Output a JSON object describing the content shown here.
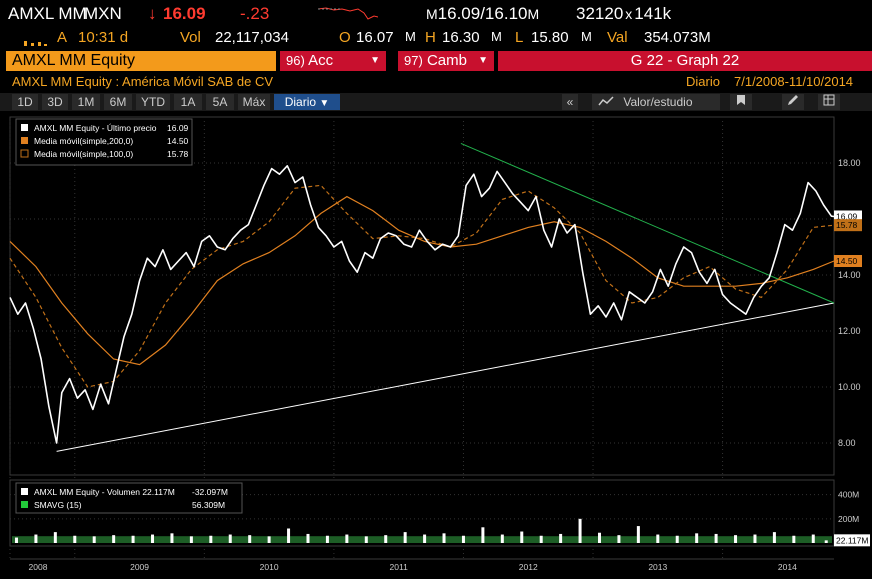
{
  "header": {
    "ticker": "AMXL MM",
    "currency": "MXN",
    "arrow": "↓",
    "last_price": "16.09",
    "change": "-.23",
    "bid_ask_prefix": "M",
    "bid_ask": "16.09/16.10",
    "bid_ask_suffix": "M",
    "sizes": "32120",
    "times": "x",
    "size2": "141k",
    "flag": "A",
    "time": "10:31 d",
    "vol_label": "Vol",
    "vol_value": "22,117,034",
    "open_label": "O",
    "open_value": "16.07",
    "open_suffix": "M",
    "high_label": "H",
    "high_value": "16.30",
    "high_suffix": "M",
    "low_label": "L",
    "low_value": "15.80",
    "low_suffix": "M",
    "val_label": "Val",
    "val_value": "354.073M"
  },
  "toolbar": {
    "security_field": "AMXL MM Equity",
    "acc_num": "96)",
    "acc_label": "Acc",
    "camb_num": "97)",
    "camb_label": "Camb",
    "graph_title": "G 22 - Graph 22"
  },
  "subheader": {
    "security_name": "AMXL MM Equity : América Móvil SAB de CV",
    "period": "Diario",
    "date_range": "7/1/2008-11/10/2014"
  },
  "range_tabs": [
    "1D",
    "3D",
    "1M",
    "6M",
    "YTD",
    "1A",
    "5A",
    "Máx"
  ],
  "frequency": "Diario",
  "frequency_arrow": "▼",
  "collapse_icon": "«",
  "study_label": "Valor/estudio",
  "chart_data": [
    {
      "type": "line",
      "legend": [
        {
          "name": "AMXL MM Equity - Último precio",
          "value": "16.09",
          "color": "#ffffff"
        },
        {
          "name": "Media móvil(simple,200,0)",
          "value": "14.50",
          "color": "#e08020"
        },
        {
          "name": "Media móvil(simple,100,0)",
          "value": "15.78",
          "color": "#c07018"
        }
      ],
      "y_ticks": [
        "8.00",
        "10.00",
        "12.00",
        "14.00",
        "16.00",
        "18.00"
      ],
      "ylim": [
        7.0,
        19.5
      ],
      "x_ticks": [
        "2008",
        "2009",
        "2010",
        "2011",
        "2012",
        "2013",
        "2014"
      ],
      "x_tick_dates": [
        2008.5,
        2009.0,
        2010.0,
        2011.0,
        2012.0,
        2013.0,
        2014.0
      ],
      "xlim": [
        2008.5,
        2014.86
      ],
      "price_tags": [
        {
          "value": "16.09",
          "y": 16.09,
          "bg": "#ffffff",
          "fg": "#000000"
        },
        {
          "value": "15.78",
          "y": 15.78,
          "bg": "#c07018",
          "fg": "#000000"
        },
        {
          "value": "14.50",
          "y": 14.5,
          "bg": "#e08020",
          "fg": "#000000"
        }
      ],
      "price_series": {
        "name": "AMXL MM Equity - Último precio",
        "x": [
          2008.5,
          2008.56,
          2008.62,
          2008.68,
          2008.74,
          2008.8,
          2008.86,
          2008.9,
          2008.96,
          2009.02,
          2009.08,
          2009.14,
          2009.2,
          2009.26,
          2009.32,
          2009.38,
          2009.44,
          2009.5,
          2009.56,
          2009.62,
          2009.68,
          2009.74,
          2009.8,
          2009.86,
          2009.92,
          2009.98,
          2010.04,
          2010.1,
          2010.16,
          2010.22,
          2010.28,
          2010.34,
          2010.4,
          2010.46,
          2010.52,
          2010.58,
          2010.64,
          2010.7,
          2010.76,
          2010.82,
          2010.88,
          2010.94,
          2011.0,
          2011.06,
          2011.12,
          2011.18,
          2011.24,
          2011.3,
          2011.36,
          2011.42,
          2011.48,
          2011.54,
          2011.6,
          2011.66,
          2011.72,
          2011.78,
          2011.84,
          2011.9,
          2011.96,
          2012.02,
          2012.08,
          2012.14,
          2012.2,
          2012.26,
          2012.32,
          2012.38,
          2012.44,
          2012.5,
          2012.56,
          2012.62,
          2012.68,
          2012.74,
          2012.8,
          2012.86,
          2012.92,
          2012.98,
          2013.04,
          2013.1,
          2013.16,
          2013.22,
          2013.28,
          2013.34,
          2013.4,
          2013.46,
          2013.52,
          2013.58,
          2013.64,
          2013.7,
          2013.76,
          2013.82,
          2013.88,
          2013.94,
          2014.0,
          2014.06,
          2014.12,
          2014.18,
          2014.24,
          2014.3,
          2014.36,
          2014.42,
          2014.48,
          2014.54,
          2014.6,
          2014.66,
          2014.72,
          2014.78,
          2014.84,
          2014.86
        ],
        "y": [
          13.2,
          12.6,
          13.0,
          12.1,
          11.0,
          9.3,
          8.0,
          9.8,
          10.3,
          9.6,
          9.9,
          9.2,
          10.1,
          9.4,
          10.6,
          11.8,
          12.6,
          13.8,
          14.6,
          14.3,
          14.9,
          14.2,
          14.5,
          14.8,
          14.3,
          15.2,
          15.4,
          15.0,
          14.9,
          15.3,
          15.6,
          15.8,
          16.5,
          17.2,
          17.8,
          17.6,
          17.9,
          17.3,
          17.5,
          16.5,
          15.7,
          15.4,
          15.0,
          15.2,
          14.5,
          14.1,
          14.8,
          14.6,
          15.3,
          15.5,
          15.4,
          15.1,
          15.0,
          15.6,
          15.2,
          14.9,
          15.1,
          15.0,
          15.4,
          17.2,
          17.6,
          16.8,
          17.1,
          17.7,
          17.3,
          16.9,
          16.6,
          16.3,
          16.8,
          15.6,
          15.0,
          16.0,
          15.5,
          15.8,
          14.1,
          12.6,
          12.9,
          12.5,
          13.0,
          12.4,
          13.4,
          13.2,
          13.0,
          13.4,
          14.2,
          13.6,
          14.4,
          15.0,
          14.8,
          14.1,
          13.7,
          14.2,
          13.3,
          13.0,
          12.8,
          12.6,
          13.2,
          13.6,
          13.9,
          14.8,
          15.8,
          15.6,
          16.2,
          17.3,
          17.0,
          16.5,
          16.1,
          16.09
        ]
      },
      "sma200_series": {
        "name": "Media móvil(simple,200,0)",
        "x": [
          2008.5,
          2008.7,
          2008.9,
          2009.1,
          2009.3,
          2009.5,
          2009.7,
          2009.9,
          2010.1,
          2010.3,
          2010.5,
          2010.7,
          2010.9,
          2011.1,
          2011.3,
          2011.5,
          2011.7,
          2011.9,
          2012.1,
          2012.3,
          2012.5,
          2012.7,
          2012.9,
          2013.1,
          2013.3,
          2013.5,
          2013.7,
          2013.9,
          2014.1,
          2014.3,
          2014.5,
          2014.7,
          2014.86
        ],
        "y": [
          15.2,
          14.3,
          13.0,
          11.9,
          11.0,
          10.8,
          11.5,
          12.6,
          13.8,
          14.4,
          14.8,
          15.4,
          16.2,
          16.8,
          16.3,
          15.6,
          15.2,
          15.0,
          15.1,
          15.4,
          15.7,
          15.9,
          15.7,
          15.2,
          14.6,
          13.9,
          13.6,
          13.6,
          13.6,
          13.7,
          13.9,
          14.2,
          14.5
        ]
      },
      "sma100_series": {
        "name": "Media móvil(simple,100,0)",
        "x": [
          2008.5,
          2008.7,
          2008.9,
          2009.1,
          2009.3,
          2009.5,
          2009.7,
          2009.9,
          2010.1,
          2010.3,
          2010.5,
          2010.7,
          2010.9,
          2011.1,
          2011.3,
          2011.5,
          2011.7,
          2011.9,
          2012.1,
          2012.3,
          2012.5,
          2012.7,
          2012.9,
          2013.1,
          2013.3,
          2013.5,
          2013.7,
          2013.9,
          2014.1,
          2014.3,
          2014.5,
          2014.7,
          2014.86
        ],
        "y": [
          14.6,
          13.2,
          11.4,
          10.0,
          10.2,
          11.3,
          13.0,
          14.2,
          14.9,
          15.2,
          15.9,
          17.1,
          17.2,
          16.2,
          15.3,
          15.4,
          15.3,
          15.0,
          15.5,
          16.7,
          17.0,
          16.4,
          15.5,
          13.8,
          13.0,
          13.2,
          13.9,
          14.3,
          13.5,
          13.2,
          14.2,
          15.7,
          15.78
        ]
      },
      "trendlines": [
        {
          "name": "support",
          "color": "#ffffff",
          "x": [
            2008.86,
            2014.86
          ],
          "y": [
            7.7,
            13.0
          ]
        },
        {
          "name": "resistance",
          "color": "#22b14c",
          "x": [
            2011.98,
            2014.86
          ],
          "y": [
            18.7,
            13.0
          ]
        }
      ]
    },
    {
      "type": "bar",
      "legend": [
        {
          "name": "AMXL MM Equity - Volumen 22.117M",
          "value": "-32.097M",
          "color": "#ffffff"
        },
        {
          "name": "SMAVG (15)",
          "value": "56.309M",
          "color": "#22c93a"
        }
      ],
      "y_ticks": [
        "200M",
        "400M"
      ],
      "ylim": [
        0,
        480
      ],
      "last_tag": "22.117M",
      "sma_level": 56.3,
      "volume": {
        "x": [
          2008.55,
          2008.7,
          2008.85,
          2009.0,
          2009.15,
          2009.3,
          2009.45,
          2009.6,
          2009.75,
          2009.9,
          2010.05,
          2010.2,
          2010.35,
          2010.5,
          2010.65,
          2010.8,
          2010.95,
          2011.1,
          2011.25,
          2011.4,
          2011.55,
          2011.7,
          2011.85,
          2012.0,
          2012.15,
          2012.3,
          2012.45,
          2012.6,
          2012.75,
          2012.9,
          2013.05,
          2013.2,
          2013.35,
          2013.5,
          2013.65,
          2013.8,
          2013.95,
          2014.1,
          2014.25,
          2014.4,
          2014.55,
          2014.7,
          2014.8
        ],
        "y": [
          45,
          70,
          90,
          60,
          55,
          65,
          60,
          70,
          80,
          55,
          60,
          70,
          65,
          55,
          120,
          75,
          60,
          70,
          55,
          65,
          90,
          70,
          80,
          60,
          130,
          70,
          95,
          60,
          75,
          200,
          85,
          65,
          140,
          70,
          60,
          80,
          75,
          65,
          70,
          90,
          60,
          70,
          22
        ]
      }
    }
  ]
}
